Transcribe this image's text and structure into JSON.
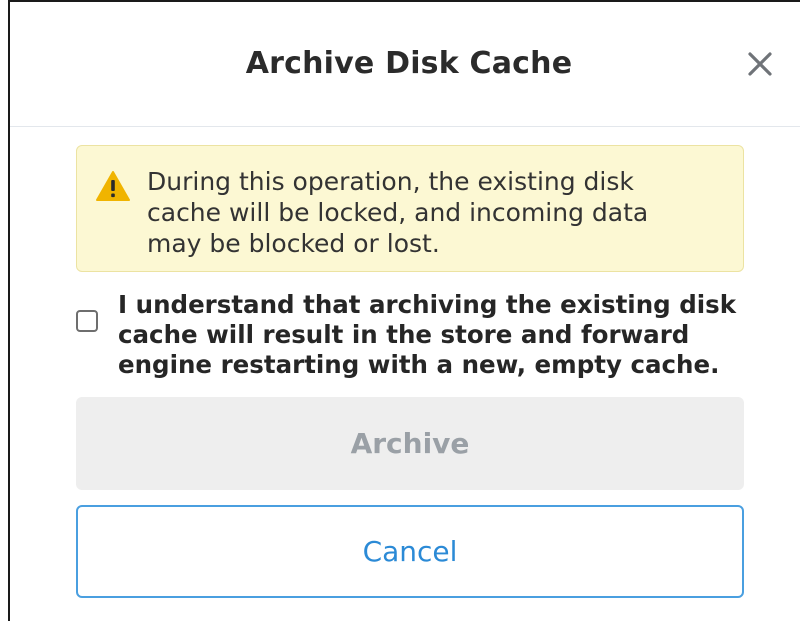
{
  "dialog": {
    "title": "Archive Disk Cache",
    "close_icon": "close-icon"
  },
  "warning": {
    "icon": "warning-triangle-icon",
    "text": "During this operation, the existing disk cache will be locked, and incoming data may be blocked or lost.",
    "colors": {
      "background": "#fcf8d3",
      "icon": "#f0b400"
    }
  },
  "confirmation": {
    "checked": false,
    "label": "I understand that archiving the existing disk cache will result in the store and forward engine restarting with a new, empty cache."
  },
  "buttons": {
    "archive_label": "Archive",
    "archive_disabled": true,
    "cancel_label": "Cancel"
  },
  "colors": {
    "accent": "#2b8ad6",
    "disabled_text": "#9aa0a6"
  }
}
